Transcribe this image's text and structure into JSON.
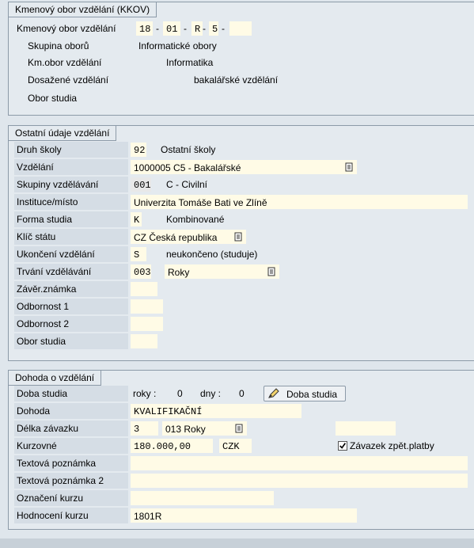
{
  "kkov": {
    "title": "Kmenový obor vzdělání (KKOV)",
    "kkov_label": "Kmenový obor vzdělání",
    "code1": "18",
    "code2": "01",
    "code3": "R",
    "code4": "5",
    "code5": "",
    "dash": "-",
    "skupina_label": "Skupina oborů",
    "skupina_value": "Informatické obory",
    "kmobor_label": "Km.obor vzdělání",
    "kmobor_value": "Informatika",
    "dosazene_label": "Dosažené vzdělání",
    "dosazene_value": "bakalářské vzdělání",
    "obor_label": "Obor studia"
  },
  "ostatni": {
    "title": "Ostatní údaje vzdělání",
    "druh_label": "Druh školy",
    "druh_code": "92",
    "druh_text": "Ostatní školy",
    "vzdelani_label": "Vzdělání",
    "vzdelani_value": "1000005 C5 - Bakalářské",
    "skupiny_label": "Skupiny vzdělávání",
    "skupiny_code": "001",
    "skupiny_text": "C - Civilní",
    "instituce_label": "Instituce/místo",
    "instituce_value": "Univerzita Tomáše Bati ve Zlíně",
    "forma_label": "Forma studia",
    "forma_code": "K",
    "forma_text": "Kombinované",
    "klic_label": "Klíč státu",
    "klic_value": "CZ Česká republika",
    "ukonceni_label": "Ukončení vzdělání",
    "ukonceni_code": "S",
    "ukonceni_text": "neukončeno (studuje)",
    "trvani_label": "Trvání vzdělávání",
    "trvani_code": "003",
    "trvani_unit": "Roky",
    "zaver_label": "Závěr.známka",
    "odb1_label": "Odbornost 1",
    "odb2_label": "Odbornost 2",
    "obor_label": "Obor studia"
  },
  "dohoda": {
    "title": "Dohoda o vzdělání",
    "doba_label": "Doba studia",
    "roky_label": "roky :",
    "roky_value": "0",
    "dny_label": "dny :",
    "dny_value": "0",
    "doba_button": "Doba studia",
    "dohoda_label": "Dohoda",
    "dohoda_value": "KVALIFIKAČNÍ",
    "delka_label": "Délka závazku",
    "delka_value": "3",
    "delka_unit": "013 Roky",
    "kurzovne_label": "Kurzovné",
    "kurzovne_value": "180.000,00",
    "kurzovne_currency": "CZK",
    "zavazek_label": "Závazek zpět.platby",
    "zavazek_checked": true,
    "text_label": "Textová poznámka",
    "text2_label": "Textová poznámka 2",
    "oznaceni_label": "Označení kurzu",
    "hodnoceni_label": "Hodnocení kurzu",
    "hodnoceni_value": "1801R"
  },
  "colors": {
    "field_bg": "#fffbe6",
    "frame": "#8c9aa8",
    "background": "#dfe6ec"
  },
  "icons": {
    "f4_help": "f4-help-icon",
    "pencil": "pencil-icon",
    "checkbox": "checkmark-icon"
  }
}
